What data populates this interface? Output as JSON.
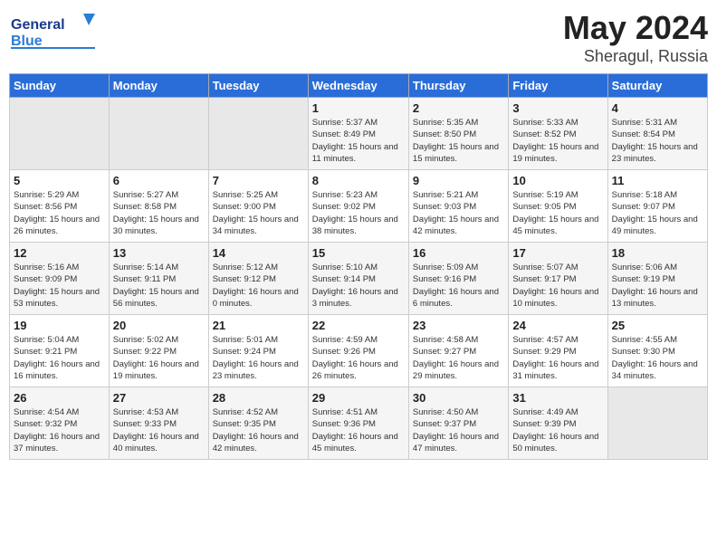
{
  "header": {
    "logo_line1": "General",
    "logo_line2": "Blue",
    "month": "May 2024",
    "location": "Sheragul, Russia"
  },
  "weekdays": [
    "Sunday",
    "Monday",
    "Tuesday",
    "Wednesday",
    "Thursday",
    "Friday",
    "Saturday"
  ],
  "weeks": [
    [
      {
        "day": "",
        "sunrise": "",
        "sunset": "",
        "daylight": "",
        "empty": true
      },
      {
        "day": "",
        "sunrise": "",
        "sunset": "",
        "daylight": "",
        "empty": true
      },
      {
        "day": "",
        "sunrise": "",
        "sunset": "",
        "daylight": "",
        "empty": true
      },
      {
        "day": "1",
        "sunrise": "5:37 AM",
        "sunset": "8:49 PM",
        "daylight": "15 hours and 11 minutes."
      },
      {
        "day": "2",
        "sunrise": "5:35 AM",
        "sunset": "8:50 PM",
        "daylight": "15 hours and 15 minutes."
      },
      {
        "day": "3",
        "sunrise": "5:33 AM",
        "sunset": "8:52 PM",
        "daylight": "15 hours and 19 minutes."
      },
      {
        "day": "4",
        "sunrise": "5:31 AM",
        "sunset": "8:54 PM",
        "daylight": "15 hours and 23 minutes."
      }
    ],
    [
      {
        "day": "5",
        "sunrise": "5:29 AM",
        "sunset": "8:56 PM",
        "daylight": "15 hours and 26 minutes."
      },
      {
        "day": "6",
        "sunrise": "5:27 AM",
        "sunset": "8:58 PM",
        "daylight": "15 hours and 30 minutes."
      },
      {
        "day": "7",
        "sunrise": "5:25 AM",
        "sunset": "9:00 PM",
        "daylight": "15 hours and 34 minutes."
      },
      {
        "day": "8",
        "sunrise": "5:23 AM",
        "sunset": "9:02 PM",
        "daylight": "15 hours and 38 minutes."
      },
      {
        "day": "9",
        "sunrise": "5:21 AM",
        "sunset": "9:03 PM",
        "daylight": "15 hours and 42 minutes."
      },
      {
        "day": "10",
        "sunrise": "5:19 AM",
        "sunset": "9:05 PM",
        "daylight": "15 hours and 45 minutes."
      },
      {
        "day": "11",
        "sunrise": "5:18 AM",
        "sunset": "9:07 PM",
        "daylight": "15 hours and 49 minutes."
      }
    ],
    [
      {
        "day": "12",
        "sunrise": "5:16 AM",
        "sunset": "9:09 PM",
        "daylight": "15 hours and 53 minutes."
      },
      {
        "day": "13",
        "sunrise": "5:14 AM",
        "sunset": "9:11 PM",
        "daylight": "15 hours and 56 minutes."
      },
      {
        "day": "14",
        "sunrise": "5:12 AM",
        "sunset": "9:12 PM",
        "daylight": "16 hours and 0 minutes."
      },
      {
        "day": "15",
        "sunrise": "5:10 AM",
        "sunset": "9:14 PM",
        "daylight": "16 hours and 3 minutes."
      },
      {
        "day": "16",
        "sunrise": "5:09 AM",
        "sunset": "9:16 PM",
        "daylight": "16 hours and 6 minutes."
      },
      {
        "day": "17",
        "sunrise": "5:07 AM",
        "sunset": "9:17 PM",
        "daylight": "16 hours and 10 minutes."
      },
      {
        "day": "18",
        "sunrise": "5:06 AM",
        "sunset": "9:19 PM",
        "daylight": "16 hours and 13 minutes."
      }
    ],
    [
      {
        "day": "19",
        "sunrise": "5:04 AM",
        "sunset": "9:21 PM",
        "daylight": "16 hours and 16 minutes."
      },
      {
        "day": "20",
        "sunrise": "5:02 AM",
        "sunset": "9:22 PM",
        "daylight": "16 hours and 19 minutes."
      },
      {
        "day": "21",
        "sunrise": "5:01 AM",
        "sunset": "9:24 PM",
        "daylight": "16 hours and 23 minutes."
      },
      {
        "day": "22",
        "sunrise": "4:59 AM",
        "sunset": "9:26 PM",
        "daylight": "16 hours and 26 minutes."
      },
      {
        "day": "23",
        "sunrise": "4:58 AM",
        "sunset": "9:27 PM",
        "daylight": "16 hours and 29 minutes."
      },
      {
        "day": "24",
        "sunrise": "4:57 AM",
        "sunset": "9:29 PM",
        "daylight": "16 hours and 31 minutes."
      },
      {
        "day": "25",
        "sunrise": "4:55 AM",
        "sunset": "9:30 PM",
        "daylight": "16 hours and 34 minutes."
      }
    ],
    [
      {
        "day": "26",
        "sunrise": "4:54 AM",
        "sunset": "9:32 PM",
        "daylight": "16 hours and 37 minutes."
      },
      {
        "day": "27",
        "sunrise": "4:53 AM",
        "sunset": "9:33 PM",
        "daylight": "16 hours and 40 minutes."
      },
      {
        "day": "28",
        "sunrise": "4:52 AM",
        "sunset": "9:35 PM",
        "daylight": "16 hours and 42 minutes."
      },
      {
        "day": "29",
        "sunrise": "4:51 AM",
        "sunset": "9:36 PM",
        "daylight": "16 hours and 45 minutes."
      },
      {
        "day": "30",
        "sunrise": "4:50 AM",
        "sunset": "9:37 PM",
        "daylight": "16 hours and 47 minutes."
      },
      {
        "day": "31",
        "sunrise": "4:49 AM",
        "sunset": "9:39 PM",
        "daylight": "16 hours and 50 minutes."
      },
      {
        "day": "",
        "sunrise": "",
        "sunset": "",
        "daylight": "",
        "empty": true
      }
    ]
  ],
  "labels": {
    "sunrise": "Sunrise:",
    "sunset": "Sunset:",
    "daylight": "Daylight:"
  }
}
